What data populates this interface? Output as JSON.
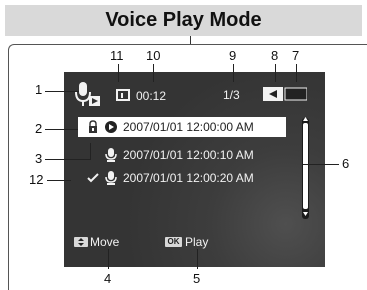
{
  "title": "Voice Play Mode",
  "screen": {
    "time": "00:12",
    "page_indicator": "1/3",
    "files": [
      {
        "datetime": "2007/01/01 12:00:00 AM",
        "selected": true,
        "locked": true
      },
      {
        "datetime": "2007/01/01 12:00:10 AM",
        "selected": false,
        "locked": false
      },
      {
        "datetime": "2007/01/01 12:00:20 AM",
        "selected": false,
        "locked": false,
        "checked": true
      }
    ],
    "move_label": "Move",
    "play_label": "Play",
    "ok_chip": "OK"
  },
  "callouts": {
    "c1": "1",
    "c2": "2",
    "c3": "3",
    "c4": "4",
    "c5": "5",
    "c6": "6",
    "c7": "7",
    "c8": "8",
    "c9": "9",
    "c10": "10",
    "c11": "11",
    "c12": "12"
  },
  "icons": {
    "mode": "voice-play-mode-icon",
    "storage": "memory-card-icon",
    "battery": "battery-icon",
    "lock": "lock-icon",
    "play": "play-icon",
    "mic": "microphone-icon",
    "check": "check-icon",
    "scroll_up": "scroll-up-icon",
    "scroll_down": "scroll-down-icon",
    "move_chip": "joystick-icon"
  }
}
